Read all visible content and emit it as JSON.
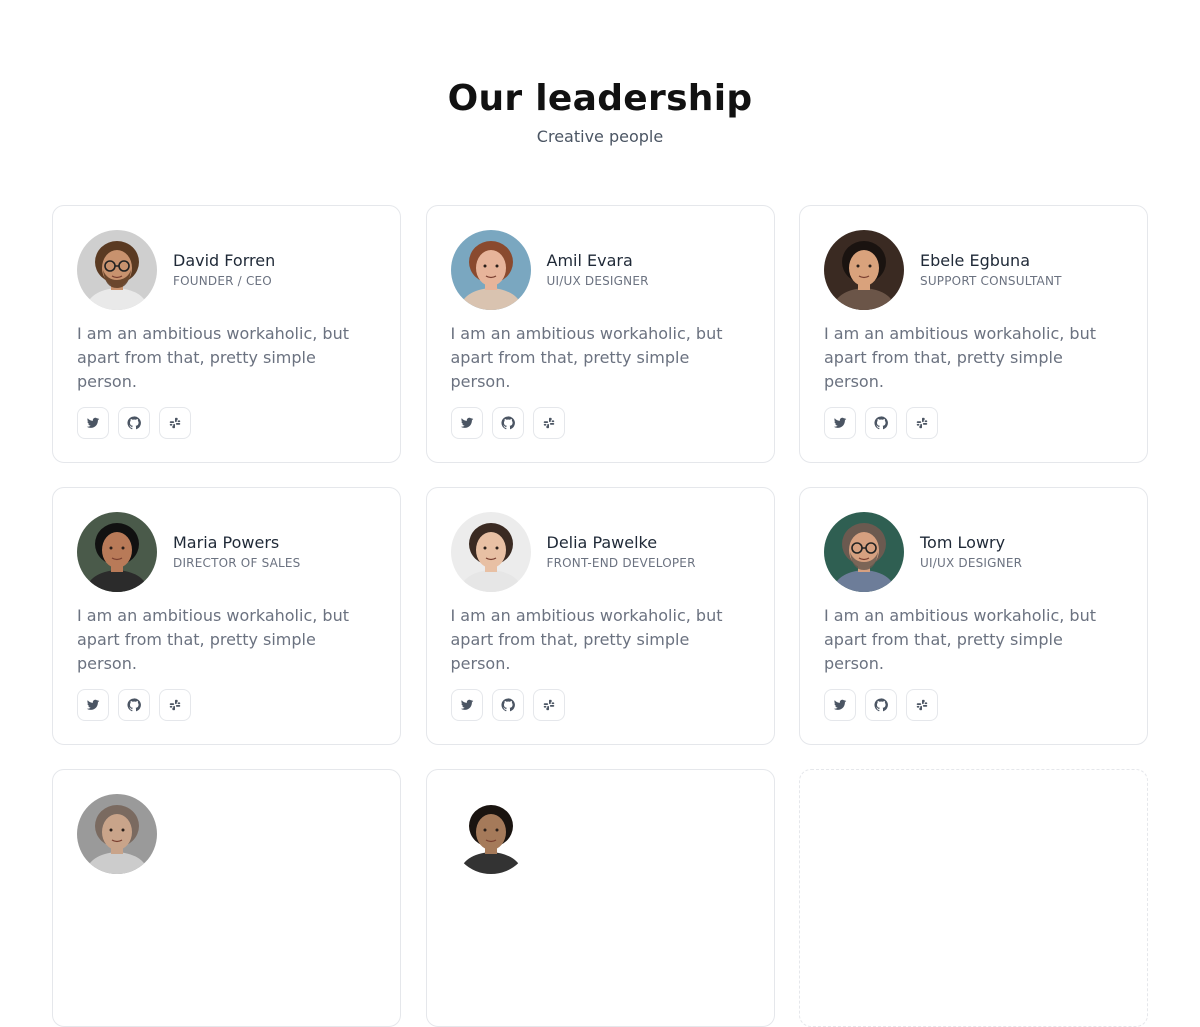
{
  "header": {
    "title": "Our leadership",
    "subtitle": "Creative people"
  },
  "colors": {
    "text": "#1f2937",
    "muted": "#6b7280",
    "border": "#e5e7eb"
  },
  "members": [
    {
      "name": "David Forren",
      "role": "Founder / CEO",
      "bio": "I am an ambitious workaholic, but apart from that, pretty simple person.",
      "avatar": {
        "bg": "#cfcfcf",
        "skin": "#c8926e",
        "hair": "#5a3a22",
        "shirt": "#e9e9e9",
        "glasses": true,
        "beard": true
      }
    },
    {
      "name": "Amil Evara",
      "role": "UI/UX Designer",
      "bio": "I am an ambitious workaholic, but apart from that, pretty simple person.",
      "avatar": {
        "bg": "#7aa7c0",
        "skin": "#e7b49a",
        "hair": "#8a4a2e",
        "shirt": "#d9c3b0",
        "glasses": false,
        "beard": false
      }
    },
    {
      "name": "Ebele Egbuna",
      "role": "Support Consultant",
      "bio": "I am an ambitious workaholic, but apart from that, pretty simple person.",
      "avatar": {
        "bg": "#3a2a22",
        "skin": "#d9a27c",
        "hair": "#1a1310",
        "shirt": "#6b5548",
        "glasses": false,
        "beard": false
      }
    },
    {
      "name": "Maria Powers",
      "role": "Director of sales",
      "bio": "I am an ambitious workaholic, but apart from that, pretty simple person.",
      "avatar": {
        "bg": "#4a5a4a",
        "skin": "#b87a58",
        "hair": "#111111",
        "shirt": "#2b2b2b",
        "glasses": false,
        "beard": false
      }
    },
    {
      "name": "Delia Pawelke",
      "role": "Front-end developer",
      "bio": "I am an ambitious workaholic, but apart from that, pretty simple person.",
      "avatar": {
        "bg": "#ececec",
        "skin": "#e8c0a4",
        "hair": "#3a2a22",
        "shirt": "#e6e6e6",
        "glasses": false,
        "beard": false
      }
    },
    {
      "name": "Tom Lowry",
      "role": "UI/UX Designer",
      "bio": "I am an ambitious workaholic, but apart from that, pretty simple person.",
      "avatar": {
        "bg": "#2f5f52",
        "skin": "#d6a080",
        "hair": "#6b5a50",
        "shirt": "#6d7d99",
        "glasses": true,
        "beard": true
      }
    },
    {
      "name": "",
      "role": "",
      "bio": "",
      "avatar": {
        "bg": "#9a9a9a",
        "skin": "#c9a48a",
        "hair": "#7a6a60",
        "shirt": "#cccccc",
        "glasses": false,
        "beard": false
      }
    },
    {
      "name": "",
      "role": "",
      "bio": "",
      "avatar": {
        "bg": "#ffffff",
        "skin": "#a57a5a",
        "hair": "#1a1410",
        "shirt": "#333333",
        "glasses": false,
        "beard": false
      }
    }
  ],
  "socials": [
    {
      "name": "twitter-icon",
      "label": "Twitter"
    },
    {
      "name": "github-icon",
      "label": "GitHub"
    },
    {
      "name": "slack-icon",
      "label": "Slack"
    }
  ]
}
